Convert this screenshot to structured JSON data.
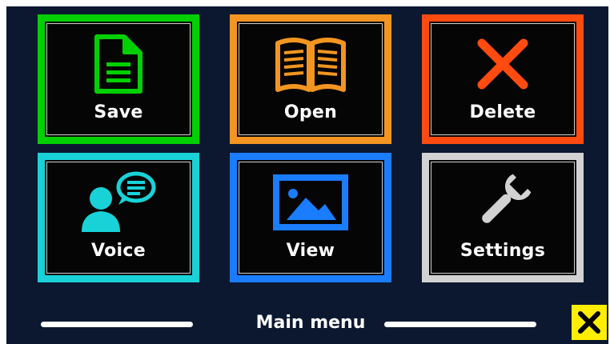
{
  "tiles": [
    {
      "label": "Save",
      "icon": "document-icon",
      "color": "#00d000"
    },
    {
      "label": "Open",
      "icon": "open-book-icon",
      "color": "#f39520"
    },
    {
      "label": "Delete",
      "icon": "close-x-icon",
      "color": "#ff4a10"
    },
    {
      "label": "Voice",
      "icon": "voice-speech-icon",
      "color": "#18d2d8"
    },
    {
      "label": "View",
      "icon": "image-icon",
      "color": "#1a7cff"
    },
    {
      "label": "Settings",
      "icon": "wrench-icon",
      "color": "#d2d2d2"
    }
  ],
  "footer": {
    "title": "Main menu",
    "close_icon": "close-icon",
    "close_color": "#ffee00"
  },
  "colors": {
    "background": "#0c1830",
    "tile_background": "#050505",
    "text": "#ffffff"
  }
}
